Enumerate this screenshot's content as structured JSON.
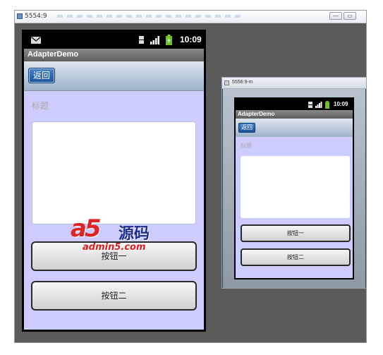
{
  "outer_window": {
    "title": "5554:9"
  },
  "phone": {
    "status_bar": {
      "time": "10:09"
    },
    "app_title": "AdapterDemo",
    "back_button_label": "返回",
    "heading_label": "标题",
    "button_one_label": "按钮一",
    "button_two_label": "按钮二"
  },
  "second_window": {
    "title": "5556:9-m",
    "status_bar": {
      "time": "10:09"
    },
    "app_title": "AdapterDemo",
    "back_button_label": "返回",
    "heading_label": "标题",
    "button_one_label": "按钮一",
    "button_two_label": "按钮二"
  },
  "watermark": {
    "logo": "a5",
    "brand": "源码",
    "site": "admin5.com"
  },
  "colors": {
    "content_bg": "#ccccff",
    "back_button": "#1b5298",
    "toolbar": "#9eb3c9"
  }
}
